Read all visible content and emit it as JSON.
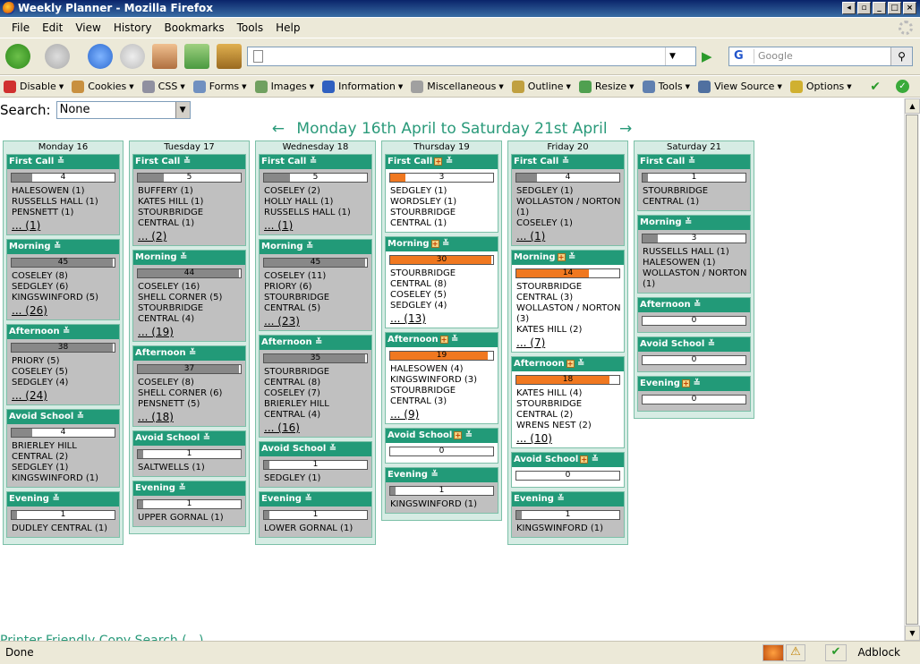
{
  "window": {
    "title": "Weekly Planner - Mozilla Firefox"
  },
  "menu": [
    "File",
    "Edit",
    "View",
    "History",
    "Bookmarks",
    "Tools",
    "Help"
  ],
  "search_engine": {
    "placeholder": "Google"
  },
  "devbar": [
    {
      "label": "Disable",
      "icon": "disable-icon",
      "color": "#d03030"
    },
    {
      "label": "Cookies",
      "icon": "cookies-icon",
      "color": "#c89040"
    },
    {
      "label": "CSS",
      "icon": "css-icon",
      "color": "#9090a0"
    },
    {
      "label": "Forms",
      "icon": "forms-icon",
      "color": "#7090c0"
    },
    {
      "label": "Images",
      "icon": "images-icon",
      "color": "#70a060"
    },
    {
      "label": "Information",
      "icon": "information-icon",
      "color": "#3060c0"
    },
    {
      "label": "Miscellaneous",
      "icon": "miscellaneous-icon",
      "color": "#a0a0a0"
    },
    {
      "label": "Outline",
      "icon": "outline-icon",
      "color": "#c0a040"
    },
    {
      "label": "Resize",
      "icon": "resize-icon",
      "color": "#50a050"
    },
    {
      "label": "Tools",
      "icon": "tools-icon",
      "color": "#6080b0"
    },
    {
      "label": "View Source",
      "icon": "view-source-icon",
      "color": "#5070a0"
    },
    {
      "label": "Options",
      "icon": "options-icon",
      "color": "#d0b030"
    }
  ],
  "page": {
    "search_label": "Search:",
    "search_value": "None",
    "prev_arrow": "←",
    "week_title": "Monday 16th April to Saturday 21st April",
    "next_arrow": "→",
    "print_link": "Printer Friendly Copy Search (...)"
  },
  "status": {
    "text": "Done",
    "adblock": "Adblock"
  },
  "days": [
    {
      "name": "Monday 16",
      "slots": [
        {
          "label": "First Call",
          "plus": false,
          "count": "4",
          "fill": 0.2,
          "orange": false,
          "white": false,
          "locations": [
            "HALESOWEN (1)",
            "RUSSELLS HALL (1)",
            "PENSNETT (1)"
          ],
          "more": "... (1)"
        },
        {
          "label": "Morning",
          "plus": false,
          "count": "45",
          "fill": 0.98,
          "orange": false,
          "white": false,
          "locations": [
            "COSELEY (8)",
            "SEDGLEY (6)",
            "KINGSWINFORD (5)"
          ],
          "more": "... (26)"
        },
        {
          "label": "Afternoon",
          "plus": false,
          "count": "38",
          "fill": 0.98,
          "orange": false,
          "white": false,
          "locations": [
            "PRIORY (5)",
            "COSELEY (5)",
            "SEDGLEY (4)"
          ],
          "more": "... (24)"
        },
        {
          "label": "Avoid School",
          "plus": false,
          "count": "4",
          "fill": 0.2,
          "orange": false,
          "white": false,
          "locations": [
            "BRIERLEY HILL CENTRAL (2)",
            "SEDGLEY (1)",
            "KINGSWINFORD (1)"
          ],
          "more": ""
        },
        {
          "label": "Evening",
          "plus": false,
          "count": "1",
          "fill": 0.05,
          "orange": false,
          "white": false,
          "locations": [
            "DUDLEY CENTRAL (1)"
          ],
          "more": ""
        }
      ]
    },
    {
      "name": "Tuesday 17",
      "slots": [
        {
          "label": "First Call",
          "plus": false,
          "count": "5",
          "fill": 0.25,
          "orange": false,
          "white": false,
          "locations": [
            "BUFFERY (1)",
            "KATES HILL (1)",
            "STOURBRIDGE CENTRAL (1)"
          ],
          "more": "... (2)"
        },
        {
          "label": "Morning",
          "plus": false,
          "count": "44",
          "fill": 0.98,
          "orange": false,
          "white": false,
          "locations": [
            "COSELEY (16)",
            "SHELL CORNER (5)",
            "STOURBRIDGE CENTRAL (4)"
          ],
          "more": "... (19)"
        },
        {
          "label": "Afternoon",
          "plus": false,
          "count": "37",
          "fill": 0.98,
          "orange": false,
          "white": false,
          "locations": [
            "COSELEY (8)",
            "SHELL CORNER (6)",
            "PENSNETT (5)"
          ],
          "more": "... (18)"
        },
        {
          "label": "Avoid School",
          "plus": false,
          "count": "1",
          "fill": 0.05,
          "orange": false,
          "white": false,
          "locations": [
            "SALTWELLS (1)"
          ],
          "more": ""
        },
        {
          "label": "Evening",
          "plus": false,
          "count": "1",
          "fill": 0.05,
          "orange": false,
          "white": false,
          "locations": [
            "UPPER GORNAL (1)"
          ],
          "more": ""
        }
      ]
    },
    {
      "name": "Wednesday 18",
      "slots": [
        {
          "label": "First Call",
          "plus": false,
          "count": "5",
          "fill": 0.25,
          "orange": false,
          "white": false,
          "locations": [
            "COSELEY (2)",
            "HOLLY HALL (1)",
            "RUSSELLS HALL (1)"
          ],
          "more": "... (1)"
        },
        {
          "label": "Morning",
          "plus": false,
          "count": "45",
          "fill": 0.98,
          "orange": false,
          "white": false,
          "locations": [
            "COSELEY (11)",
            "PRIORY (6)",
            "STOURBRIDGE CENTRAL (5)"
          ],
          "more": "... (23)"
        },
        {
          "label": "Afternoon",
          "plus": false,
          "count": "35",
          "fill": 0.98,
          "orange": false,
          "white": false,
          "locations": [
            "STOURBRIDGE CENTRAL (8)",
            "COSELEY (7)",
            "BRIERLEY HILL CENTRAL (4)"
          ],
          "more": "... (16)"
        },
        {
          "label": "Avoid School",
          "plus": false,
          "count": "1",
          "fill": 0.05,
          "orange": false,
          "white": false,
          "locations": [
            "SEDGLEY (1)"
          ],
          "more": ""
        },
        {
          "label": "Evening",
          "plus": false,
          "count": "1",
          "fill": 0.05,
          "orange": false,
          "white": false,
          "locations": [
            "LOWER GORNAL (1)"
          ],
          "more": ""
        }
      ]
    },
    {
      "name": "Thursday 19",
      "slots": [
        {
          "label": "First Call",
          "plus": true,
          "count": "3",
          "fill": 0.15,
          "orange": true,
          "white": true,
          "locations": [
            "SEDGLEY (1)",
            "WORDSLEY (1)",
            "STOURBRIDGE CENTRAL (1)"
          ],
          "more": ""
        },
        {
          "label": "Morning",
          "plus": true,
          "count": "30",
          "fill": 0.98,
          "orange": true,
          "white": true,
          "locations": [
            "STOURBRIDGE CENTRAL (8)",
            "COSELEY (5)",
            "SEDGLEY (4)"
          ],
          "more": "... (13)"
        },
        {
          "label": "Afternoon",
          "plus": true,
          "count": "19",
          "fill": 0.95,
          "orange": true,
          "white": true,
          "locations": [
            "HALESOWEN (4)",
            "KINGSWINFORD (3)",
            "STOURBRIDGE CENTRAL (3)"
          ],
          "more": "... (9)"
        },
        {
          "label": "Avoid School",
          "plus": true,
          "count": "0",
          "fill": 0,
          "orange": true,
          "white": true,
          "locations": [],
          "more": ""
        },
        {
          "label": "Evening",
          "plus": false,
          "count": "1",
          "fill": 0.05,
          "orange": false,
          "white": false,
          "locations": [
            "KINGSWINFORD (1)"
          ],
          "more": ""
        }
      ]
    },
    {
      "name": "Friday 20",
      "slots": [
        {
          "label": "First Call",
          "plus": false,
          "count": "4",
          "fill": 0.2,
          "orange": false,
          "white": false,
          "locations": [
            "SEDGLEY (1)",
            "WOLLASTON / NORTON (1)",
            "COSELEY (1)"
          ],
          "more": "... (1)"
        },
        {
          "label": "Morning",
          "plus": true,
          "count": "14",
          "fill": 0.7,
          "orange": true,
          "white": true,
          "locations": [
            "STOURBRIDGE CENTRAL (3)",
            "WOLLASTON / NORTON (3)",
            "KATES HILL (2)"
          ],
          "more": "... (7)"
        },
        {
          "label": "Afternoon",
          "plus": true,
          "count": "18",
          "fill": 0.9,
          "orange": true,
          "white": true,
          "locations": [
            "KATES HILL (4)",
            "STOURBRIDGE CENTRAL (2)",
            "WRENS NEST (2)"
          ],
          "more": "... (10)"
        },
        {
          "label": "Avoid School",
          "plus": true,
          "count": "0",
          "fill": 0,
          "orange": true,
          "white": true,
          "locations": [],
          "more": ""
        },
        {
          "label": "Evening",
          "plus": false,
          "count": "1",
          "fill": 0.05,
          "orange": false,
          "white": false,
          "locations": [
            "KINGSWINFORD (1)"
          ],
          "more": ""
        }
      ]
    },
    {
      "name": "Saturday 21",
      "slots": [
        {
          "label": "First Call",
          "plus": false,
          "count": "1",
          "fill": 0.05,
          "orange": false,
          "white": false,
          "locations": [
            "STOURBRIDGE CENTRAL (1)"
          ],
          "more": ""
        },
        {
          "label": "Morning",
          "plus": false,
          "count": "3",
          "fill": 0.15,
          "orange": false,
          "white": false,
          "locations": [
            "RUSSELLS HALL (1)",
            "HALESOWEN (1)",
            "WOLLASTON / NORTON (1)"
          ],
          "more": ""
        },
        {
          "label": "Afternoon",
          "plus": false,
          "count": "0",
          "fill": 0,
          "orange": false,
          "white": false,
          "locations": [],
          "more": ""
        },
        {
          "label": "Avoid School",
          "plus": false,
          "count": "0",
          "fill": 0,
          "orange": false,
          "white": false,
          "locations": [],
          "more": ""
        },
        {
          "label": "Evening",
          "plus": true,
          "count": "0",
          "fill": 0,
          "orange": false,
          "white": false,
          "locations": [],
          "more": ""
        }
      ]
    }
  ]
}
